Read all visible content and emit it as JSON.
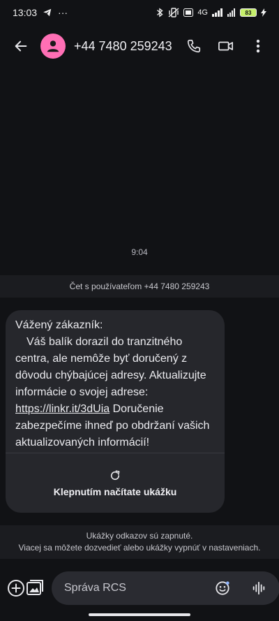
{
  "status_bar": {
    "time": "13:03",
    "ellipsis": "···",
    "network": "4G",
    "battery": "83"
  },
  "header": {
    "contact": "+44 7480 259243"
  },
  "conversation": {
    "timestamp": "9:04",
    "banner": "Čet s používateľom +44 7480 259243",
    "message": {
      "greeting": "Vážený zákazník:",
      "body_start": "Váš balík dorazil do tranzitného centra, ale nemôže byť doručený z dôvodu chýbajúcej adresy. Aktualizujte informácie o svojej adrese:",
      "link": "https://linkr.it/3dUia",
      "body_end": "Doručenie zabezpečíme ihneď po obdržaní vašich aktualizovaných informácií!"
    },
    "preview_label": "Klepnutím načítate ukážku"
  },
  "preview_notice": {
    "line1": "Ukážky odkazov sú zapnuté.",
    "line2": "Viacej sa môžete dozvedieť alebo ukážky vypnúť v nastaveniach."
  },
  "composer": {
    "placeholder": "Správa RCS"
  },
  "colors": {
    "background": "#111215",
    "bubble": "#26272c",
    "avatar": "#ff6fb5",
    "battery": "#c6f06b"
  }
}
